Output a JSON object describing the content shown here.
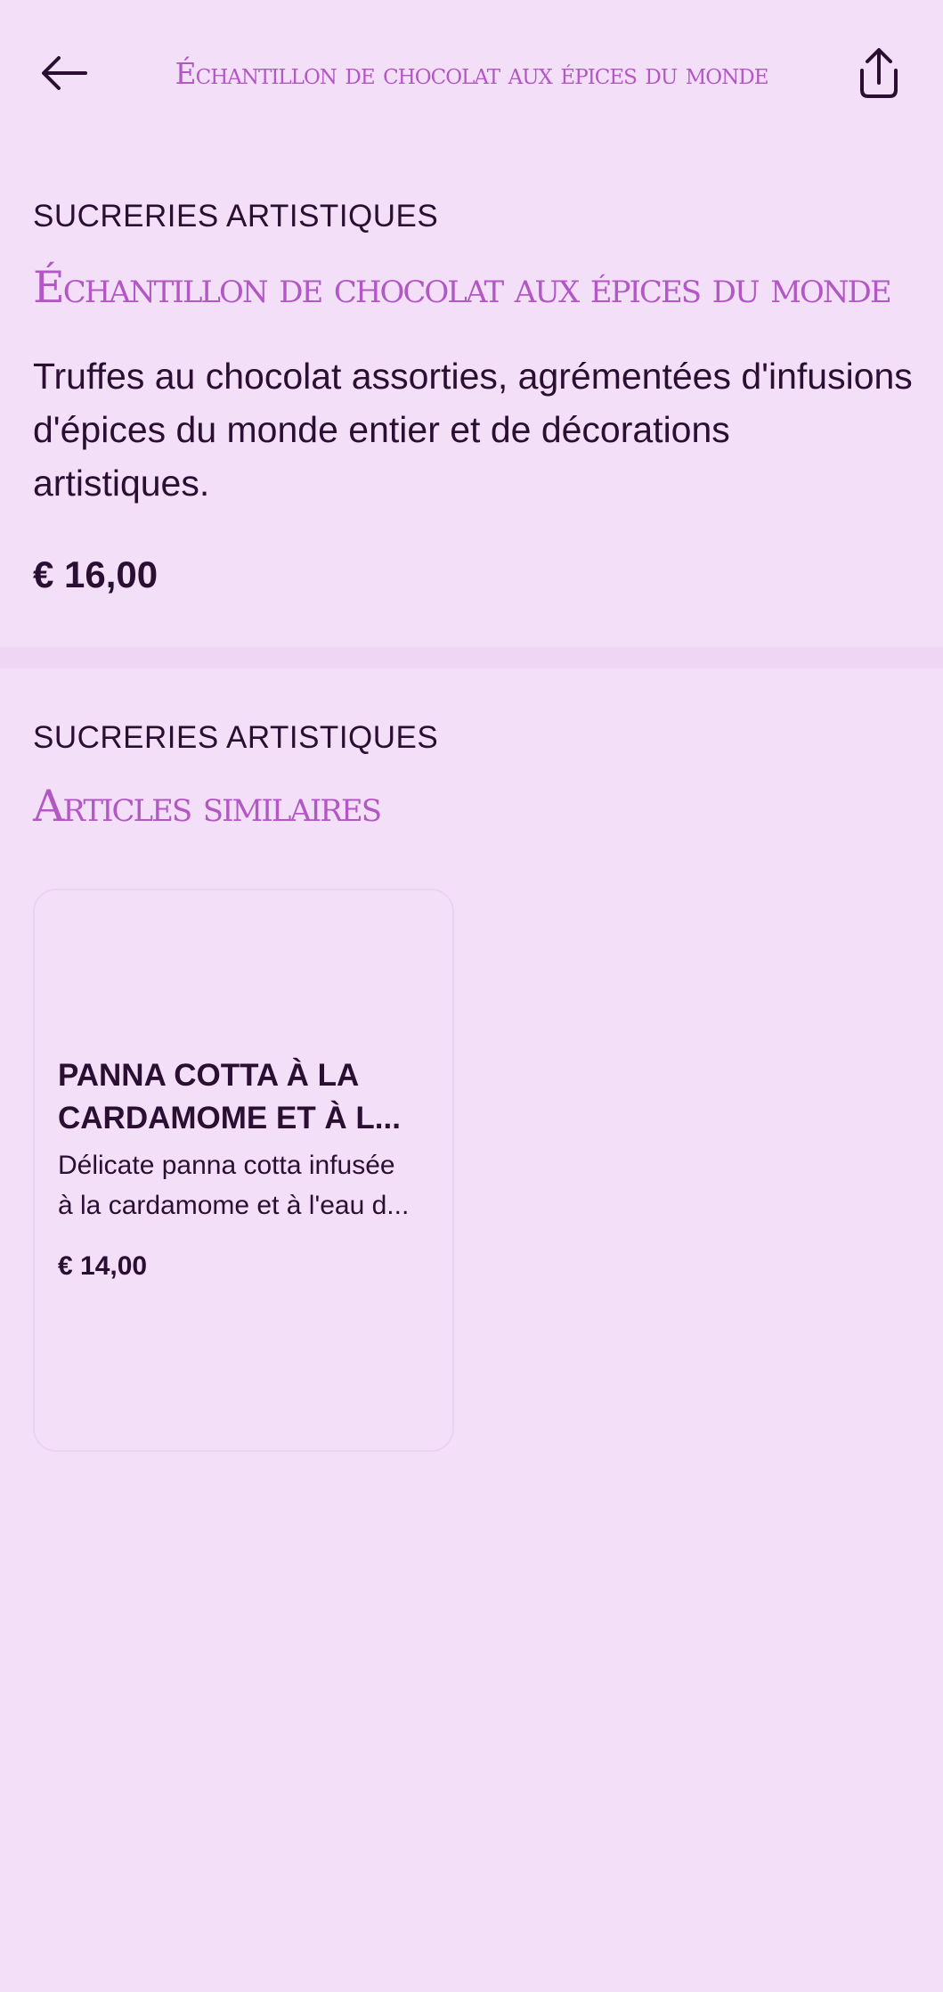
{
  "header": {
    "title": "Échantillon de chocolat aux épices du monde",
    "back_icon": "arrow-left-icon",
    "share_icon": "share-icon"
  },
  "product": {
    "category": "SUCRERIES ARTISTIQUES",
    "title": "Échantillon de chocolat aux épices du monde",
    "description": "Truffes au chocolat assorties, agrémentées d'infusions d'épices du monde entier et de décorations artistiques.",
    "price": "€ 16,00"
  },
  "similar": {
    "category": "SUCRERIES ARTISTIQUES",
    "title": "Articles similaires",
    "items": [
      {
        "title_line1": "PANNA COTTA À LA",
        "title_line2": "CARDAMOME ET À L...",
        "desc_line1": "Délicate panna cotta infusée",
        "desc_line2": "à la cardamome et à l'eau d...",
        "price": "€ 14,00"
      }
    ]
  },
  "colors": {
    "background": "#f3e0f8",
    "accent": "#b257c4",
    "text": "#2b0f33",
    "divider": "#f0d6f5"
  }
}
